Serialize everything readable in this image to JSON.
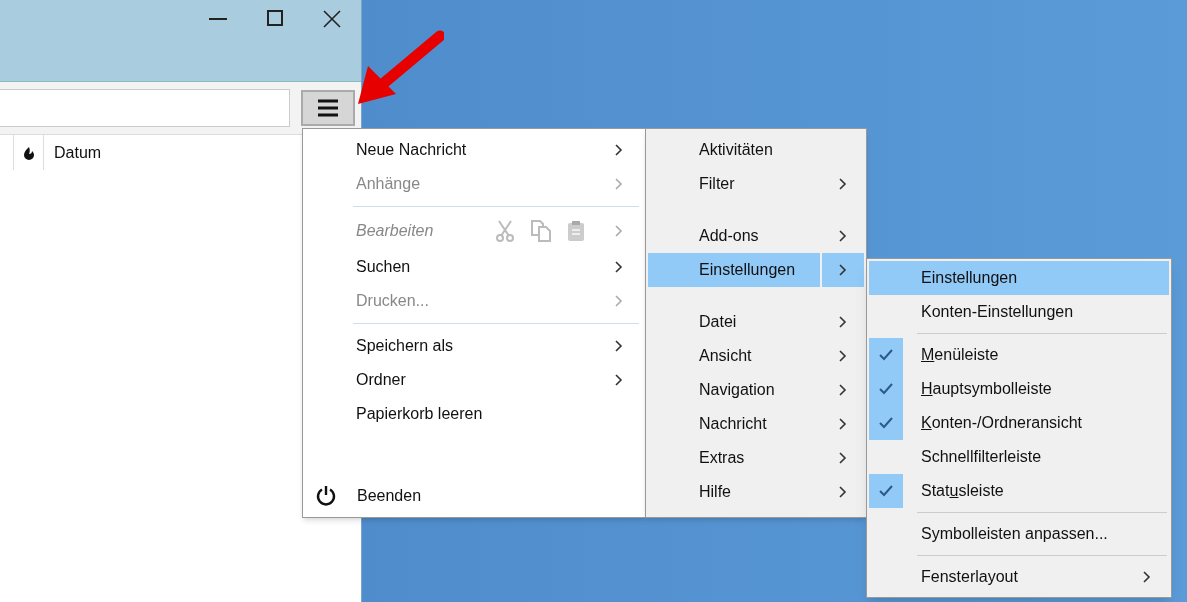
{
  "window": {
    "column_header": "Datum"
  },
  "main_menu": [
    {
      "kind": "item",
      "label": "Neue Nachricht",
      "has_submenu": true,
      "disabled": false
    },
    {
      "kind": "item",
      "label": "Anhänge",
      "has_submenu": true,
      "disabled": true
    },
    {
      "kind": "separator"
    },
    {
      "kind": "edit",
      "label": "Bearbeiten",
      "has_submenu": true,
      "disabled": true
    },
    {
      "kind": "item",
      "label": "Suchen",
      "has_submenu": true,
      "disabled": false
    },
    {
      "kind": "item",
      "label": "Drucken...",
      "has_submenu": true,
      "disabled": true
    },
    {
      "kind": "separator"
    },
    {
      "kind": "item",
      "label": "Speichern als",
      "has_submenu": true,
      "disabled": false
    },
    {
      "kind": "item",
      "label": "Ordner",
      "has_submenu": true,
      "disabled": false
    },
    {
      "kind": "item",
      "label": "Papierkorb leeren",
      "has_submenu": false,
      "disabled": false
    },
    {
      "kind": "quit",
      "label": "Beenden",
      "has_submenu": false,
      "disabled": false
    }
  ],
  "side_menu": [
    {
      "kind": "item",
      "label": "Aktivitäten",
      "has_submenu": false,
      "selected": false
    },
    {
      "kind": "item",
      "label": "Filter",
      "has_submenu": true,
      "selected": false
    },
    {
      "kind": "spacer"
    },
    {
      "kind": "item",
      "label": "Add-ons",
      "has_submenu": true,
      "selected": false
    },
    {
      "kind": "item",
      "label": "Einstellungen",
      "has_submenu": true,
      "selected": true
    },
    {
      "kind": "spacer"
    },
    {
      "kind": "item",
      "label": "Datei",
      "has_submenu": true,
      "selected": false
    },
    {
      "kind": "item",
      "label": "Ansicht",
      "has_submenu": true,
      "selected": false
    },
    {
      "kind": "item",
      "label": "Navigation",
      "has_submenu": true,
      "selected": false
    },
    {
      "kind": "item",
      "label": "Nachricht",
      "has_submenu": true,
      "selected": false
    },
    {
      "kind": "item",
      "label": "Extras",
      "has_submenu": true,
      "selected": false
    },
    {
      "kind": "item",
      "label": "Hilfe",
      "has_submenu": true,
      "selected": false
    }
  ],
  "settings_menu": [
    {
      "kind": "item",
      "label_parts": [
        {
          "text": "Einstellungen",
          "underlined": false
        }
      ],
      "selected": true,
      "has_submenu": false
    },
    {
      "kind": "item",
      "label_parts": [
        {
          "text": "Konten-Einstellungen",
          "underlined": false
        }
      ],
      "selected": false,
      "has_submenu": false
    },
    {
      "kind": "separator"
    },
    {
      "kind": "check",
      "label_parts": [
        {
          "text": "M",
          "underlined": true
        },
        {
          "text": "enüleiste",
          "underlined": false
        }
      ],
      "checked": true
    },
    {
      "kind": "check",
      "label_parts": [
        {
          "text": "H",
          "underlined": true
        },
        {
          "text": "auptsymbolleiste",
          "underlined": false
        }
      ],
      "checked": true
    },
    {
      "kind": "check",
      "label_parts": [
        {
          "text": "K",
          "underlined": true
        },
        {
          "text": "onten-/Ordneransicht",
          "underlined": false
        }
      ],
      "checked": true
    },
    {
      "kind": "check",
      "label_parts": [
        {
          "text": "Schnellfilterleiste",
          "underlined": false
        }
      ],
      "checked": false
    },
    {
      "kind": "check",
      "label_parts": [
        {
          "text": "Stat",
          "underlined": false
        },
        {
          "text": "u",
          "underlined": true
        },
        {
          "text": "sleiste",
          "underlined": false
        }
      ],
      "checked": true
    },
    {
      "kind": "separator"
    },
    {
      "kind": "item",
      "label_parts": [
        {
          "text": "Symbolleisten anpassen...",
          "underlined": false
        }
      ],
      "selected": false,
      "has_submenu": false
    },
    {
      "kind": "separator"
    },
    {
      "kind": "item",
      "label_parts": [
        {
          "text": "Fensterlayout",
          "underlined": false
        }
      ],
      "selected": false,
      "has_submenu": true
    }
  ]
}
